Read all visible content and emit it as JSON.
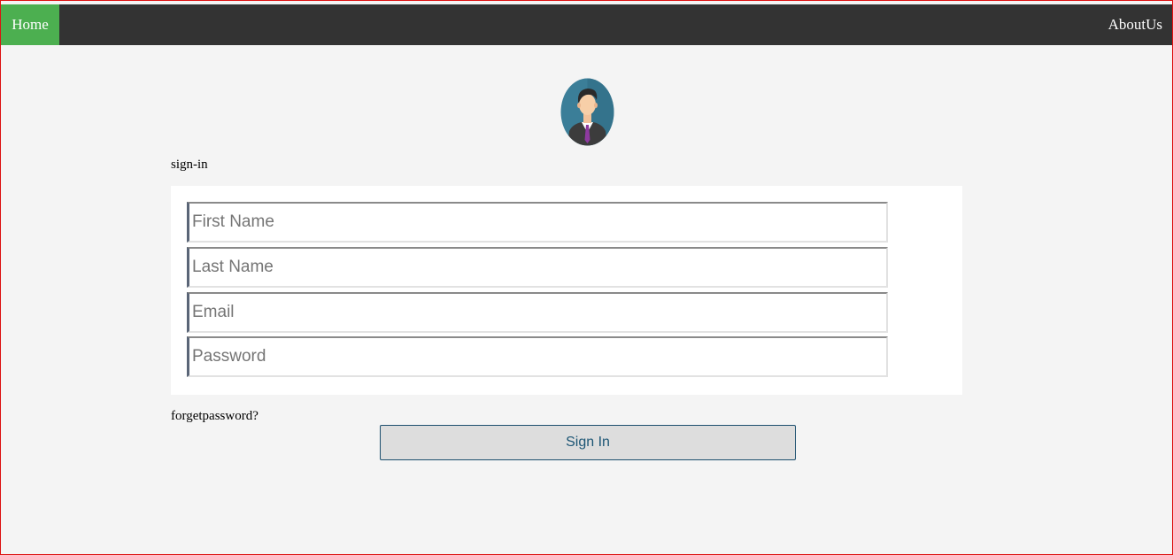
{
  "nav": {
    "home_label": "Home",
    "about_label": "AboutUs",
    "active_color": "#4caf50",
    "bar_color": "#333333"
  },
  "avatar": {
    "icon": "user-avatar-icon"
  },
  "form": {
    "title": "sign-in",
    "fields": [
      {
        "name": "first-name",
        "placeholder": "First Name",
        "value": ""
      },
      {
        "name": "last-name",
        "placeholder": "Last Name",
        "value": ""
      },
      {
        "name": "email",
        "placeholder": "Email",
        "value": ""
      },
      {
        "name": "password",
        "placeholder": "Password",
        "value": ""
      }
    ],
    "forgot_label": "forgetpassword?",
    "submit_label": "Sign In"
  }
}
